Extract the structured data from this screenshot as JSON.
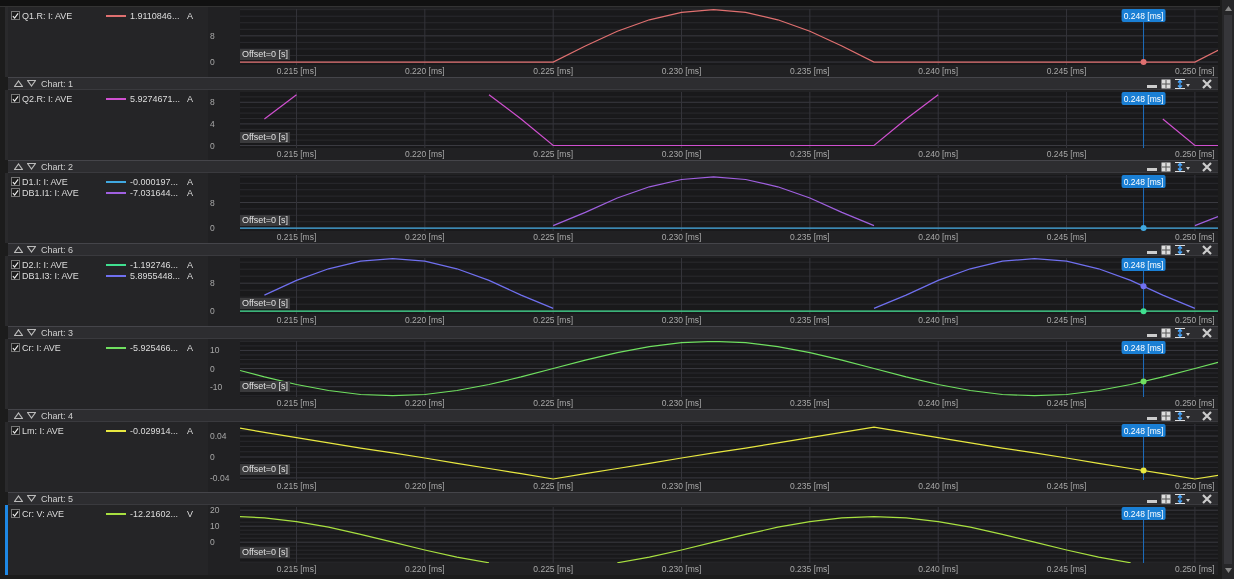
{
  "panels": [
    {
      "selected": false,
      "signals": [
        {
          "checked": true,
          "value": "1.9110846...",
          "unit": "A"
        }
      ],
      "offset_label": "Offset=0 [s]",
      "cursor_label": "0.248 [ms]",
      "chart_data": {
        "type": "line",
        "grid": true,
        "xlim": [
          0.2128,
          0.2509
        ],
        "ylim": [
          -0.9,
          16.2
        ],
        "x": [
          0.2128,
          0.21375,
          0.215,
          0.21625,
          0.2175,
          0.21875,
          0.22,
          0.22125,
          0.2225,
          0.22375,
          0.225,
          0.22625,
          0.2275,
          0.22875,
          0.23,
          0.23125,
          0.2325,
          0.23375,
          0.235,
          0.23625,
          0.2375,
          0.23875,
          0.24,
          0.24125,
          0.2425,
          0.24375,
          0.245,
          0.24625,
          0.2475,
          0.24875,
          0.25,
          0.2509
        ],
        "xticks": [
          {
            "value": 0.215,
            "label": "0.215 [ms]"
          },
          {
            "value": 0.22,
            "label": "0.220 [ms]"
          },
          {
            "value": 0.225,
            "label": "0.225 [ms]"
          },
          {
            "value": 0.23,
            "label": "0.230 [ms]"
          },
          {
            "value": 0.235,
            "label": "0.235 [ms]"
          },
          {
            "value": 0.24,
            "label": "0.240 [ms]"
          },
          {
            "value": 0.245,
            "label": "0.245 [ms]"
          },
          {
            "value": 0.25,
            "label": "0.250 [ms]"
          }
        ],
        "yticks": [
          0,
          8
        ],
        "series": [
          {
            "name": "Q1.R: I: AVE",
            "color": "#e07070",
            "values": [
              0,
              0,
              0,
              0,
              0,
              0,
              0,
              0,
              0,
              0,
              0,
              4.9,
              9.4,
              12.9,
              15.2,
              16,
              15.2,
              12.9,
              9.4,
              4.9,
              0,
              0,
              0,
              0,
              0,
              0,
              0,
              0,
              0,
              0,
              0,
              3.6
            ]
          }
        ],
        "ref_lines": [
          {
            "axis": "x",
            "value": 0.248
          }
        ]
      }
    },
    {
      "title": "Chart: 1",
      "selected": false,
      "signals": [
        {
          "checked": true,
          "value": "5.9274671...",
          "unit": "A"
        }
      ],
      "offset_label": "Offset=0 [s]",
      "cursor_label": "0.248 [ms]",
      "chart_data": {
        "type": "line",
        "grid": true,
        "xlim": [
          0.2128,
          0.2509
        ],
        "ylim": [
          -0.46,
          9.9
        ],
        "x": [
          0.21375,
          0.215,
          0.21625,
          0.2175,
          0.21875,
          0.22,
          0.22125,
          0.2225,
          0.22375,
          0.225,
          0.22625,
          0.2275,
          0.22875,
          0.23,
          0.23125,
          0.2325,
          0.23375,
          0.235,
          0.23625,
          0.2375,
          0.23875,
          0.24,
          0.24125,
          0.2425,
          0.24375,
          0.245,
          0.24625,
          0.2475,
          0.24875,
          0.25,
          0.2509
        ],
        "xticks": [
          {
            "value": 0.215,
            "label": "0.215 [ms]"
          },
          {
            "value": 0.22,
            "label": "0.220 [ms]"
          },
          {
            "value": 0.225,
            "label": "0.225 [ms]"
          },
          {
            "value": 0.23,
            "label": "0.230 [ms]"
          },
          {
            "value": 0.235,
            "label": "0.235 [ms]"
          },
          {
            "value": 0.24,
            "label": "0.240 [ms]"
          },
          {
            "value": 0.245,
            "label": "0.245 [ms]"
          },
          {
            "value": 0.25,
            "label": "0.250 [ms]"
          }
        ],
        "yticks": [
          0,
          4,
          8
        ],
        "series": [
          {
            "name": "Q2.R: I: AVE",
            "color": "#d050d0",
            "values": [
              4.9,
              9.4,
              null,
              null,
              null,
              null,
              null,
              9.4,
              4.9,
              0,
              0,
              0,
              0,
              0,
              0,
              0,
              0,
              0,
              0,
              0,
              4.9,
              9.4,
              null,
              null,
              null,
              null,
              null,
              null,
              4.9,
              0,
              0
            ]
          }
        ],
        "ref_lines": [
          {
            "axis": "x",
            "value": 0.248
          }
        ]
      }
    },
    {
      "title": "Chart: 2",
      "selected": false,
      "signals": [
        {
          "checked": true,
          "value": "-0.000197...",
          "unit": "A"
        },
        {
          "checked": true,
          "value": "-7.031644...",
          "unit": "A"
        }
      ],
      "offset_label": "Offset=0 [s]",
      "cursor_label": "0.248 [ms]",
      "chart_data": {
        "type": "line",
        "grid": true,
        "xlim": [
          0.2128,
          0.2509
        ],
        "ylim": [
          -0.9,
          16.6
        ],
        "x": [
          0.2128,
          0.21375,
          0.215,
          0.21625,
          0.2175,
          0.21875,
          0.22,
          0.22125,
          0.2225,
          0.22375,
          0.225,
          0.22625,
          0.2275,
          0.22875,
          0.23,
          0.23125,
          0.2325,
          0.23375,
          0.235,
          0.23625,
          0.2375,
          0.23875,
          0.24,
          0.24125,
          0.2425,
          0.24375,
          0.245,
          0.24625,
          0.2475,
          0.24875,
          0.25,
          0.2509
        ],
        "xticks": [
          {
            "value": 0.215,
            "label": "0.215 [ms]"
          },
          {
            "value": 0.22,
            "label": "0.220 [ms]"
          },
          {
            "value": 0.225,
            "label": "0.225 [ms]"
          },
          {
            "value": 0.23,
            "label": "0.230 [ms]"
          },
          {
            "value": 0.235,
            "label": "0.235 [ms]"
          },
          {
            "value": 0.24,
            "label": "0.240 [ms]"
          },
          {
            "value": 0.245,
            "label": "0.245 [ms]"
          },
          {
            "value": 0.25,
            "label": "0.250 [ms]"
          }
        ],
        "yticks": [
          0,
          8
        ],
        "series": [
          {
            "name": "D1.I: I: AVE",
            "color": "#40a8e0",
            "values": [
              0,
              0,
              0,
              0,
              0,
              0,
              0,
              0,
              0,
              0,
              0,
              0,
              0,
              0,
              0,
              0,
              0,
              0,
              0,
              0,
              0,
              0,
              0,
              0,
              0,
              0,
              0,
              0,
              0,
              0,
              0,
              0
            ]
          },
          {
            "name": "DB1.I1: I: AVE",
            "color": "#a060e0",
            "values": [
              null,
              null,
              null,
              null,
              null,
              null,
              null,
              null,
              null,
              null,
              0.8,
              4.9,
              9.4,
              12.9,
              15.2,
              16,
              15.2,
              12.9,
              9.4,
              4.9,
              0.8,
              null,
              null,
              null,
              null,
              null,
              null,
              null,
              null,
              null,
              0.8,
              3.6
            ]
          }
        ],
        "ref_lines": [
          {
            "axis": "x",
            "value": 0.248
          }
        ]
      }
    },
    {
      "title": "Chart: 6",
      "selected": false,
      "signals": [
        {
          "checked": true,
          "value": "-1.192746...",
          "unit": "A"
        },
        {
          "checked": true,
          "value": "5.8955448...",
          "unit": "A"
        }
      ],
      "offset_label": "Offset=0 [s]",
      "cursor_label": "0.248 [ms]",
      "chart_data": {
        "type": "line",
        "grid": true,
        "xlim": [
          0.2128,
          0.2509
        ],
        "ylim": [
          -0.8,
          15.2
        ],
        "x": [
          0.2128,
          0.21375,
          0.215,
          0.21625,
          0.2175,
          0.21875,
          0.22,
          0.22125,
          0.2225,
          0.22375,
          0.225,
          0.22625,
          0.2275,
          0.22875,
          0.23,
          0.23125,
          0.2325,
          0.23375,
          0.235,
          0.23625,
          0.2375,
          0.23875,
          0.24,
          0.24125,
          0.2425,
          0.24375,
          0.245,
          0.24625,
          0.2475,
          0.24875,
          0.25,
          0.2509
        ],
        "xticks": [
          {
            "value": 0.215,
            "label": "0.215 [ms]"
          },
          {
            "value": 0.22,
            "label": "0.220 [ms]"
          },
          {
            "value": 0.225,
            "label": "0.225 [ms]"
          },
          {
            "value": 0.23,
            "label": "0.230 [ms]"
          },
          {
            "value": 0.235,
            "label": "0.235 [ms]"
          },
          {
            "value": 0.24,
            "label": "0.240 [ms]"
          },
          {
            "value": 0.245,
            "label": "0.245 [ms]"
          },
          {
            "value": 0.25,
            "label": "0.250 [ms]"
          }
        ],
        "yticks": [
          0,
          8
        ],
        "series": [
          {
            "name": "D2.I: I: AVE",
            "color": "#40e090",
            "values": [
              0,
              0,
              0,
              0,
              0,
              0,
              0,
              0,
              0,
              0,
              0,
              0,
              0,
              0,
              0,
              0,
              0,
              0,
              0,
              0,
              0,
              0,
              0,
              0,
              0,
              0,
              0,
              0,
              0,
              0,
              0,
              0
            ]
          },
          {
            "name": "DB1.I3: I: AVE",
            "color": "#7070f0",
            "values": [
              null,
              4.6,
              8.8,
              12.1,
              14.3,
              15,
              14.3,
              12.1,
              8.8,
              4.6,
              0.8,
              null,
              null,
              null,
              null,
              null,
              null,
              null,
              null,
              null,
              0.8,
              4.6,
              8.8,
              12.1,
              14.3,
              15,
              14.3,
              12.1,
              8.8,
              4.6,
              0.8,
              null
            ]
          }
        ],
        "ref_lines": [
          {
            "axis": "x",
            "value": 0.248
          }
        ]
      }
    },
    {
      "title": "Chart: 3",
      "selected": false,
      "signals": [
        {
          "checked": true,
          "value": "-5.925466...",
          "unit": "A"
        }
      ],
      "offset_label": "Offset=0 [s]",
      "cursor_label": "0.248 [ms]",
      "chart_data": {
        "type": "line",
        "grid": true,
        "xlim": [
          0.2128,
          0.2509
        ],
        "ylim": [
          -15.7,
          15.2
        ],
        "x": [
          0.2128,
          0.21375,
          0.215,
          0.21625,
          0.2175,
          0.21875,
          0.22,
          0.22125,
          0.2225,
          0.22375,
          0.225,
          0.22625,
          0.2275,
          0.22875,
          0.23,
          0.23125,
          0.2325,
          0.23375,
          0.235,
          0.23625,
          0.2375,
          0.23875,
          0.24,
          0.24125,
          0.2425,
          0.24375,
          0.245,
          0.24625,
          0.2475,
          0.24875,
          0.25,
          0.2509
        ],
        "xticks": [
          {
            "value": 0.215,
            "label": "0.215 [ms]"
          },
          {
            "value": 0.22,
            "label": "0.220 [ms]"
          },
          {
            "value": 0.225,
            "label": "0.225 [ms]"
          },
          {
            "value": 0.23,
            "label": "0.230 [ms]"
          },
          {
            "value": 0.235,
            "label": "0.235 [ms]"
          },
          {
            "value": 0.24,
            "label": "0.240 [ms]"
          },
          {
            "value": 0.245,
            "label": "0.245 [ms]"
          },
          {
            "value": 0.25,
            "label": "0.250 [ms]"
          }
        ],
        "yticks": [
          -10,
          0,
          10
        ],
        "series": [
          {
            "name": "Cr: I: AVE",
            "color": "#70e060",
            "values": [
              -1.1,
              -4.6,
              -8.8,
              -12.1,
              -14.3,
              -15,
              -14.3,
              -12.1,
              -8.8,
              -4.6,
              0,
              4.6,
              8.8,
              12.1,
              14.3,
              15,
              14.3,
              12.1,
              8.8,
              4.6,
              0,
              -4.6,
              -8.8,
              -12.1,
              -14.3,
              -15,
              -14.3,
              -12.1,
              -8.8,
              -4.6,
              0,
              3.4
            ]
          }
        ],
        "ref_lines": [
          {
            "axis": "x",
            "value": 0.248
          }
        ]
      }
    },
    {
      "title": "Chart: 4",
      "selected": false,
      "signals": [
        {
          "checked": true,
          "value": "-0.029914...",
          "unit": "A"
        }
      ],
      "offset_label": "Offset=0 [s]",
      "cursor_label": "0.248 [ms]",
      "chart_data": {
        "type": "line",
        "grid": true,
        "xlim": [
          0.2128,
          0.2509
        ],
        "ylim": [
          -0.044,
          0.063
        ],
        "x": [
          0.2128,
          0.21375,
          0.215,
          0.21625,
          0.2175,
          0.21875,
          0.22,
          0.22125,
          0.2225,
          0.22375,
          0.225,
          0.22625,
          0.2275,
          0.22875,
          0.23,
          0.23125,
          0.2325,
          0.23375,
          0.235,
          0.23625,
          0.2375,
          0.23875,
          0.24,
          0.24125,
          0.2425,
          0.24375,
          0.245,
          0.24625,
          0.2475,
          0.24875,
          0.25,
          0.2509
        ],
        "xticks": [
          {
            "value": 0.215,
            "label": "0.215 [ms]"
          },
          {
            "value": 0.22,
            "label": "0.220 [ms]"
          },
          {
            "value": 0.225,
            "label": "0.225 [ms]"
          },
          {
            "value": 0.23,
            "label": "0.230 [ms]"
          },
          {
            "value": 0.235,
            "label": "0.235 [ms]"
          },
          {
            "value": 0.24,
            "label": "0.240 [ms]"
          },
          {
            "value": 0.245,
            "label": "0.245 [ms]"
          },
          {
            "value": 0.25,
            "label": "0.250 [ms]"
          }
        ],
        "yticks": [
          -0.04,
          0,
          0.04
        ],
        "series": [
          {
            "name": "Lm: I: AVE",
            "color": "#e8e840",
            "values": [
              0.055,
              0.047,
              0.037,
              0.027,
              0.017,
              0.008,
              -0.002,
              -0.012,
              -0.022,
              -0.032,
              -0.042,
              -0.032,
              -0.022,
              -0.012,
              -0.002,
              0.008,
              0.017,
              0.027,
              0.037,
              0.047,
              0.057,
              0.047,
              0.037,
              0.027,
              0.017,
              0.008,
              -0.002,
              -0.012,
              -0.022,
              -0.032,
              -0.042,
              -0.035
            ]
          }
        ],
        "ref_lines": [
          {
            "axis": "x",
            "value": 0.248
          }
        ]
      }
    },
    {
      "title": "Chart: 5",
      "selected": true,
      "signals": [
        {
          "checked": true,
          "value": "-12.21602...",
          "unit": "V"
        }
      ],
      "offset_label": "Offset=0 [s]",
      "cursor_label": "0.248 [ms]",
      "chart_data": {
        "type": "line",
        "grid": true,
        "xlim": [
          0.2128,
          0.2509
        ],
        "ylim": [
          -13,
          22
        ],
        "x": [
          0.2128,
          0.21375,
          0.215,
          0.21625,
          0.2175,
          0.21875,
          0.22,
          0.22125,
          0.2225,
          0.22375,
          0.225,
          0.22625,
          0.2275,
          0.22875,
          0.23,
          0.23125,
          0.2325,
          0.23375,
          0.235,
          0.23625,
          0.2375,
          0.23875,
          0.24,
          0.24125,
          0.2425,
          0.24375,
          0.245,
          0.24625,
          0.2475
        ],
        "xticks": [
          {
            "value": 0.215,
            "label": "0.215 [ms]"
          },
          {
            "value": 0.22,
            "label": "0.220 [ms]"
          },
          {
            "value": 0.225,
            "label": "0.225 [ms]"
          },
          {
            "value": 0.23,
            "label": "0.230 [ms]"
          },
          {
            "value": 0.235,
            "label": "0.235 [ms]"
          },
          {
            "value": 0.24,
            "label": "0.240 [ms]"
          },
          {
            "value": 0.245,
            "label": "0.245 [ms]"
          },
          {
            "value": 0.25,
            "label": "0.250 [ms]"
          }
        ],
        "yticks": [
          0,
          10,
          20
        ],
        "series": [
          {
            "name": "Cr: V: AVE",
            "color": "#a8e040",
            "values": [
              16,
              15.2,
              12.9,
              9.4,
              4.9,
              0,
              -4.9,
              -9.4,
              -12.9,
              null,
              null,
              null,
              -12.9,
              -9.4,
              -4.9,
              0,
              4.9,
              9.4,
              12.9,
              15.2,
              16,
              15.2,
              12.9,
              9.4,
              4.9,
              0,
              -4.9,
              -9.4,
              -12.9
            ]
          }
        ],
        "ref_lines": [
          {
            "axis": "x",
            "value": 0.248
          }
        ]
      }
    }
  ]
}
